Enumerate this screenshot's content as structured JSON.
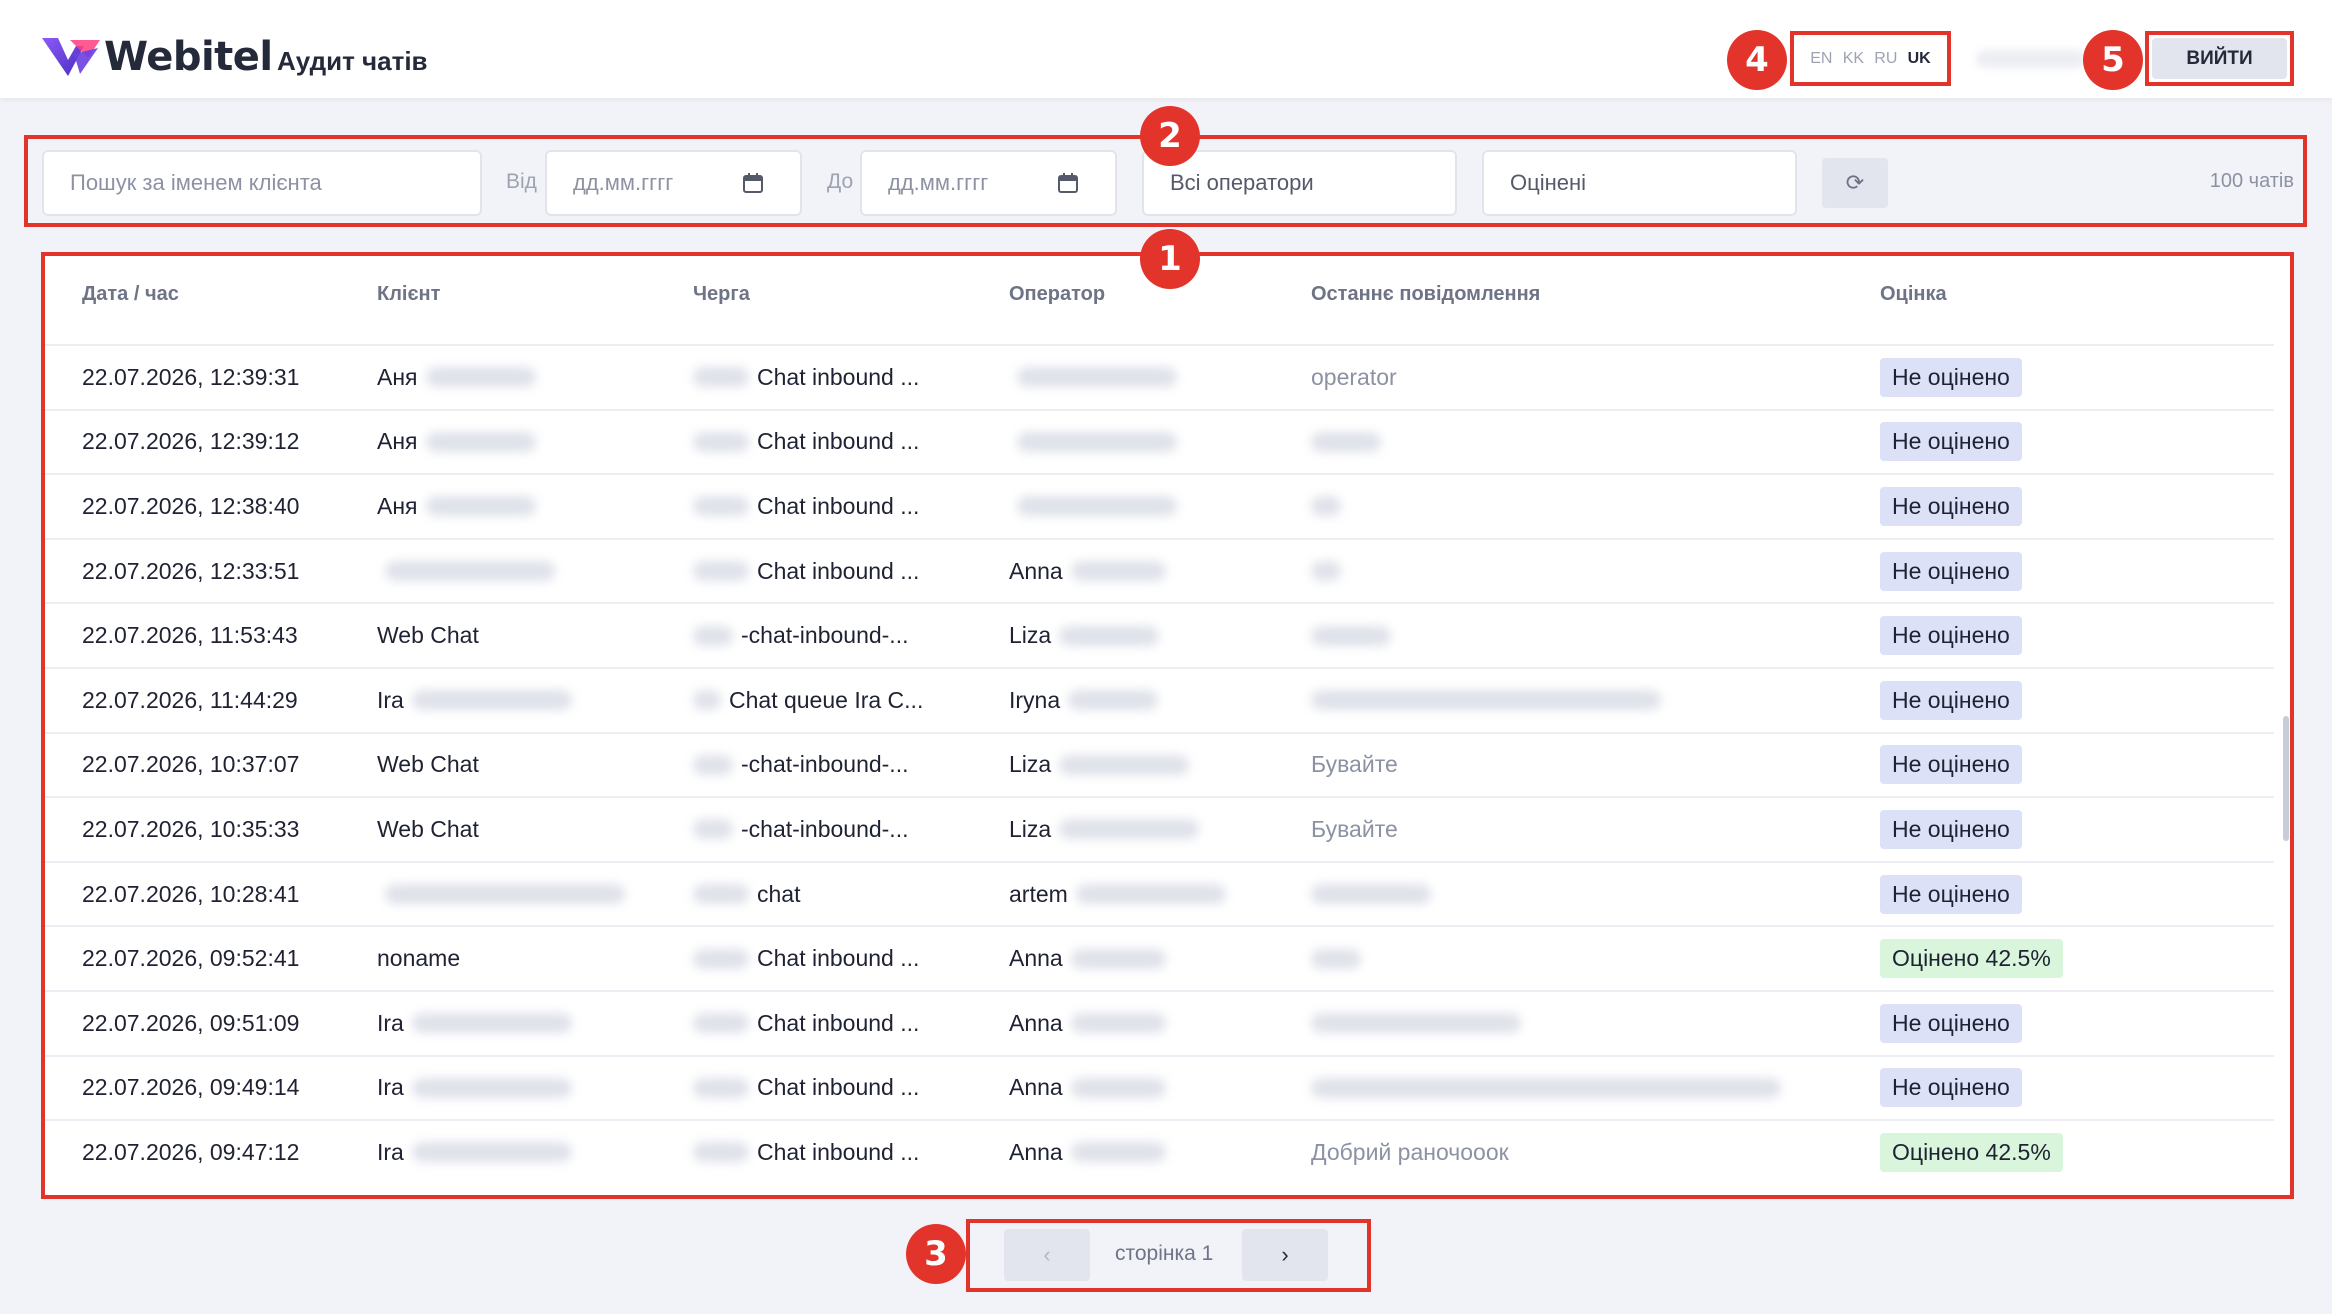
{
  "header": {
    "brand": "Webitel",
    "title": "Аудит чатів",
    "languages": [
      "EN",
      "KK",
      "RU",
      "UK"
    ],
    "active_language": "UK",
    "logout_label": "ВИЙТИ"
  },
  "annotations": [
    "1",
    "2",
    "3",
    "4",
    "5"
  ],
  "filters": {
    "search_placeholder": "Пошук за іменем клієнта",
    "from_label": "Від",
    "to_label": "До",
    "from_placeholder": "дд.мм.гггг",
    "to_placeholder": "дд.мм.гггг",
    "operator_value": "Всі оператори",
    "rating_value": "Оцінені",
    "refresh_icon": "⟳",
    "count_text": "100 чатів"
  },
  "table": {
    "columns": [
      "Дата / час",
      "Клієнт",
      "Черга",
      "Оператор",
      "Останнє повідомлення",
      "Оцінка"
    ],
    "rows": [
      {
        "datetime": "22.07.2026, 12:39:31",
        "client": "Аня",
        "queue": "Chat inbound ...",
        "operator": "",
        "last_message": "operator",
        "rating": "Не оцінено",
        "rated": false
      },
      {
        "datetime": "22.07.2026, 12:39:12",
        "client": "Аня",
        "queue": "Chat inbound ...",
        "operator": "",
        "last_message": "",
        "rating": "Не оцінено",
        "rated": false
      },
      {
        "datetime": "22.07.2026, 12:38:40",
        "client": "Аня",
        "queue": "Chat inbound ...",
        "operator": "",
        "last_message": "",
        "rating": "Не оцінено",
        "rated": false
      },
      {
        "datetime": "22.07.2026, 12:33:51",
        "client": "",
        "queue": "Chat inbound ...",
        "operator": "Anna",
        "last_message": "",
        "rating": "Не оцінено",
        "rated": false
      },
      {
        "datetime": "22.07.2026, 11:53:43",
        "client": "Web Chat",
        "queue": "-chat-inbound-...",
        "operator": "Liza",
        "last_message": "",
        "rating": "Не оцінено",
        "rated": false
      },
      {
        "datetime": "22.07.2026, 11:44:29",
        "client": "Ira",
        "queue": "Chat queue Ira C...",
        "operator": "Iryna",
        "last_message": "",
        "rating": "Не оцінено",
        "rated": false
      },
      {
        "datetime": "22.07.2026, 10:37:07",
        "client": "Web Chat",
        "queue": "-chat-inbound-...",
        "operator": "Liza",
        "last_message": "Бувайте",
        "rating": "Не оцінено",
        "rated": false
      },
      {
        "datetime": "22.07.2026, 10:35:33",
        "client": "Web Chat",
        "queue": "-chat-inbound-...",
        "operator": "Liza",
        "last_message": "Бувайте",
        "rating": "Не оцінено",
        "rated": false
      },
      {
        "datetime": "22.07.2026, 10:28:41",
        "client": "",
        "queue": "chat",
        "operator": "artem",
        "last_message": "",
        "rating": "Не оцінено",
        "rated": false
      },
      {
        "datetime": "22.07.2026, 09:52:41",
        "client": "noname",
        "queue": "Chat inbound ...",
        "operator": "Anna",
        "last_message": "",
        "rating": "Оцінено 42.5%",
        "rated": true
      },
      {
        "datetime": "22.07.2026, 09:51:09",
        "client": "Ira",
        "queue": "Chat inbound ...",
        "operator": "Anna",
        "last_message": "",
        "rating": "Не оцінено",
        "rated": false
      },
      {
        "datetime": "22.07.2026, 09:49:14",
        "client": "Ira",
        "queue": "Chat inbound ...",
        "operator": "Anna",
        "last_message": "",
        "rating": "Не оцінено",
        "rated": false
      },
      {
        "datetime": "22.07.2026, 09:47:12",
        "client": "Ira",
        "queue": "Chat inbound ...",
        "operator": "Anna",
        "last_message": "Добрий раночооок",
        "rating": "Оцінено 42.5%",
        "rated": true
      }
    ]
  },
  "pagination": {
    "prev_label": "‹",
    "next_label": "›",
    "page_label": "сторінка 1"
  },
  "colors": {
    "annotation_red": "#e2342b",
    "badge_unrated": "#dde1f8",
    "badge_rated": "#d9f5dc",
    "brand_purple": "#6a3fe0"
  }
}
